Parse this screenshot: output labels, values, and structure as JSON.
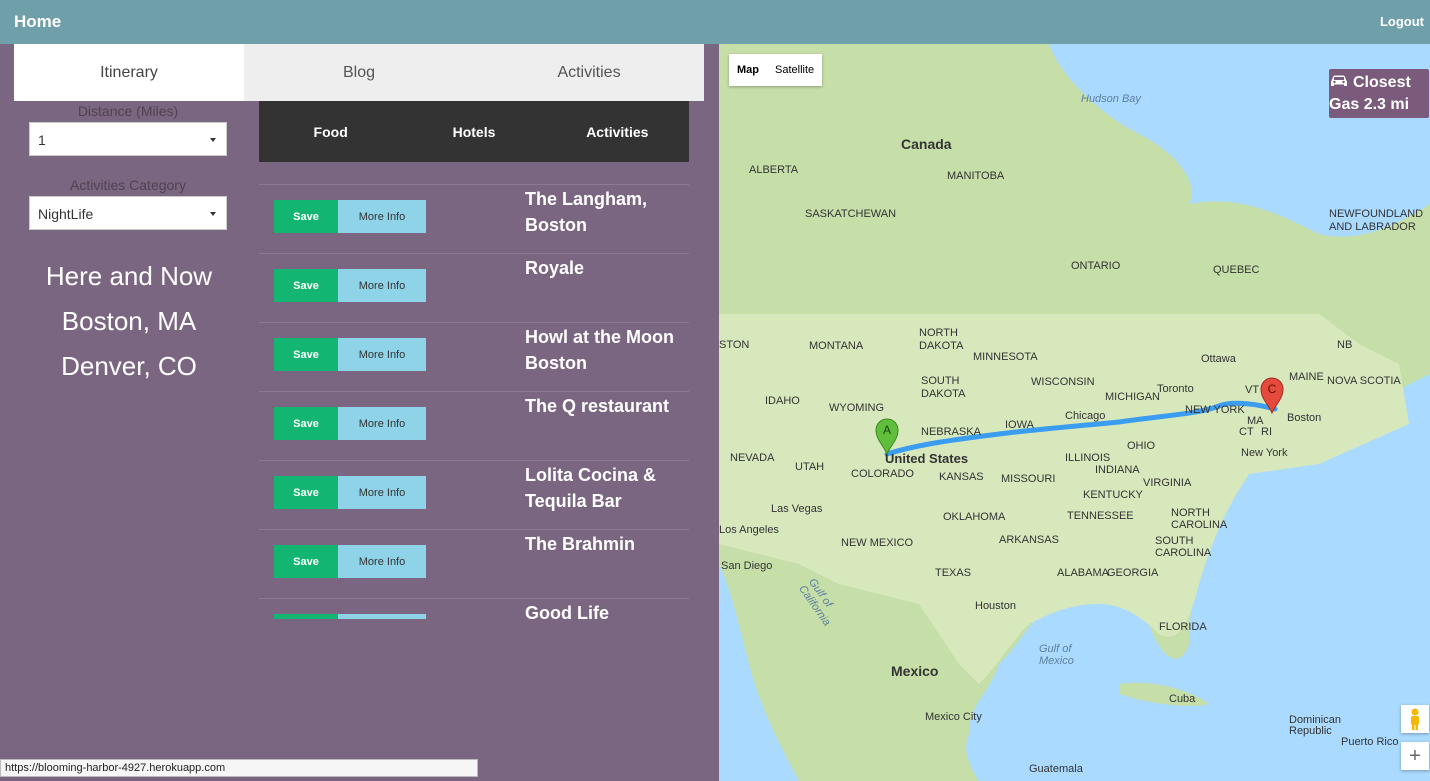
{
  "nav": {
    "home": "Home",
    "logout": "Logout"
  },
  "tabs": [
    {
      "label": "Itinerary"
    },
    {
      "label": "Blog"
    },
    {
      "label": "Activities"
    }
  ],
  "filters": {
    "distance_label": "Distance (Miles)",
    "distance_value": "1",
    "category_label": "Activities Category",
    "category_value": "NightLife"
  },
  "places": [
    "Here and Now",
    "Boston, MA",
    "Denver, CO"
  ],
  "subtabs": [
    {
      "label": "Food"
    },
    {
      "label": "Hotels"
    },
    {
      "label": "Activities"
    }
  ],
  "buttons": {
    "save": "Save",
    "more_info": "More Info"
  },
  "results": [
    {
      "name": "The Langham, Boston"
    },
    {
      "name": "Royale"
    },
    {
      "name": "Howl at the Moon Boston"
    },
    {
      "name": "The Q restaurant"
    },
    {
      "name": "Lolita Cocina & Tequila Bar"
    },
    {
      "name": "The Brahmin"
    },
    {
      "name": "Good Life"
    }
  ],
  "map": {
    "toggle_map": "Map",
    "toggle_satellite": "Satellite",
    "gas_line1": "Closest",
    "gas_line2": "Gas 2.3 mi",
    "marker_a": "A",
    "marker_c": "C",
    "labels": [
      "Hudson Bay",
      "Canada",
      "ALBERTA",
      "MANITOBA",
      "SASKATCHEWAN",
      "ONTARIO",
      "QUEBEC",
      "NEWFOUNDLAND AND LABRADOR",
      "MONTANA",
      "NORTH DAKOTA",
      "MINNESOTA",
      "SOUTH DAKOTA",
      "WISCONSIN",
      "WYOMING",
      "IDAHO",
      "NEBRASKA",
      "IOWA",
      "United States",
      "NEVADA",
      "UTAH",
      "COLORADO",
      "KANSAS",
      "MISSOURI",
      "ILLINOIS",
      "INDIANA",
      "OHIO",
      "Chicago",
      "MICHIGAN",
      "Toronto",
      "Ottawa",
      "NEW YORK",
      "Boston",
      "New York",
      "MAINE",
      "NOVA SCOTIA",
      "NB",
      "Las Vegas",
      "Los Angeles",
      "San Diego",
      "OKLAHOMA",
      "NEW MEXICO",
      "TEXAS",
      "Houston",
      "Mexico",
      "Mexico City",
      "Cuba",
      "Gulf of Mexico",
      "Gulf of California",
      "FLORIDA",
      "TENNESSEE",
      "KENTUCKY",
      "VIRGINIA",
      "NORTH CAROLINA",
      "SOUTH CAROLINA",
      "GEORGIA",
      "ALABAMA",
      "ARKANSAS",
      "Dominican Republic",
      "Puerto Rico",
      "Guatemala",
      "MA",
      "CT",
      "RI",
      "VT",
      "STON"
    ]
  },
  "status_url": "https://blooming-harbor-4927.herokuapp.com"
}
